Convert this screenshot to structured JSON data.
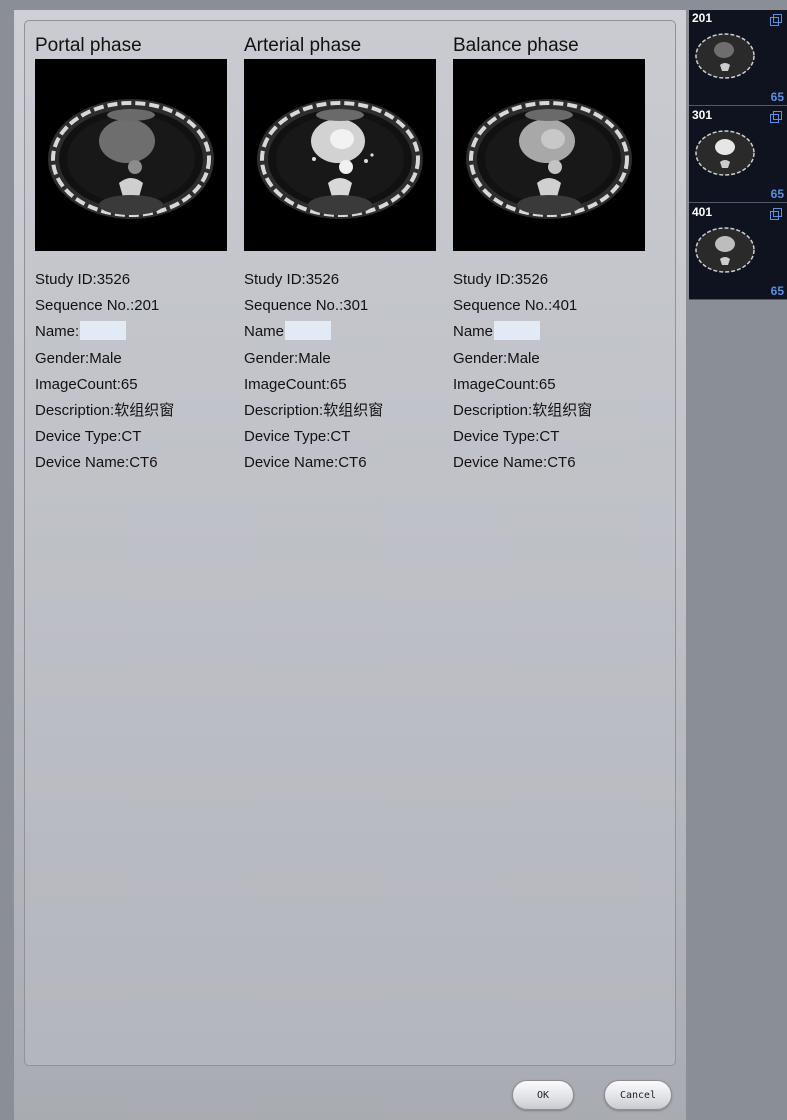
{
  "series": [
    {
      "title": "Portal phase",
      "study_id": "Study ID:3526",
      "sequence_no": "Sequence No.:201",
      "name": "Name:",
      "gender": "Gender:Male",
      "image_count": "ImageCount:65",
      "description": "Description:软组织窗",
      "device_type": "Device Type:CT",
      "device_name": "Device Name:CT6"
    },
    {
      "title": "Arterial phase",
      "study_id": "Study ID:3526",
      "sequence_no": "Sequence No.:301",
      "name": "Name",
      "gender": "Gender:Male",
      "image_count": "ImageCount:65",
      "description": "Description:软组织窗",
      "device_type": "Device Type:CT",
      "device_name": "Device Name:CT6"
    },
    {
      "title": "Balance phase",
      "study_id": "Study ID:3526",
      "sequence_no": "Sequence No.:401",
      "name": "Name",
      "gender": "Gender:Male",
      "image_count": "ImageCount:65",
      "description": "Description:软组织窗",
      "device_type": "Device Type:CT",
      "device_name": "Device Name:CT6"
    }
  ],
  "buttons": {
    "ok": "OK",
    "cancel": "Cancel"
  },
  "thumbnails": [
    {
      "series_number": "201",
      "image_count": "65"
    },
    {
      "series_number": "301",
      "image_count": "65"
    },
    {
      "series_number": "401",
      "image_count": "65"
    }
  ],
  "icons": {
    "thumbnail_corner": "stack-icon",
    "ct_scan": "ct-axial-chest-image"
  },
  "colors": {
    "background": "#8a8e97",
    "dialog_top": "#cfd0d6",
    "dialog_bottom": "#a9abb2",
    "sidebar_background": "#0f1320",
    "thumbnail_count": "#5e8fe0",
    "redaction": "#e2eaf6"
  }
}
